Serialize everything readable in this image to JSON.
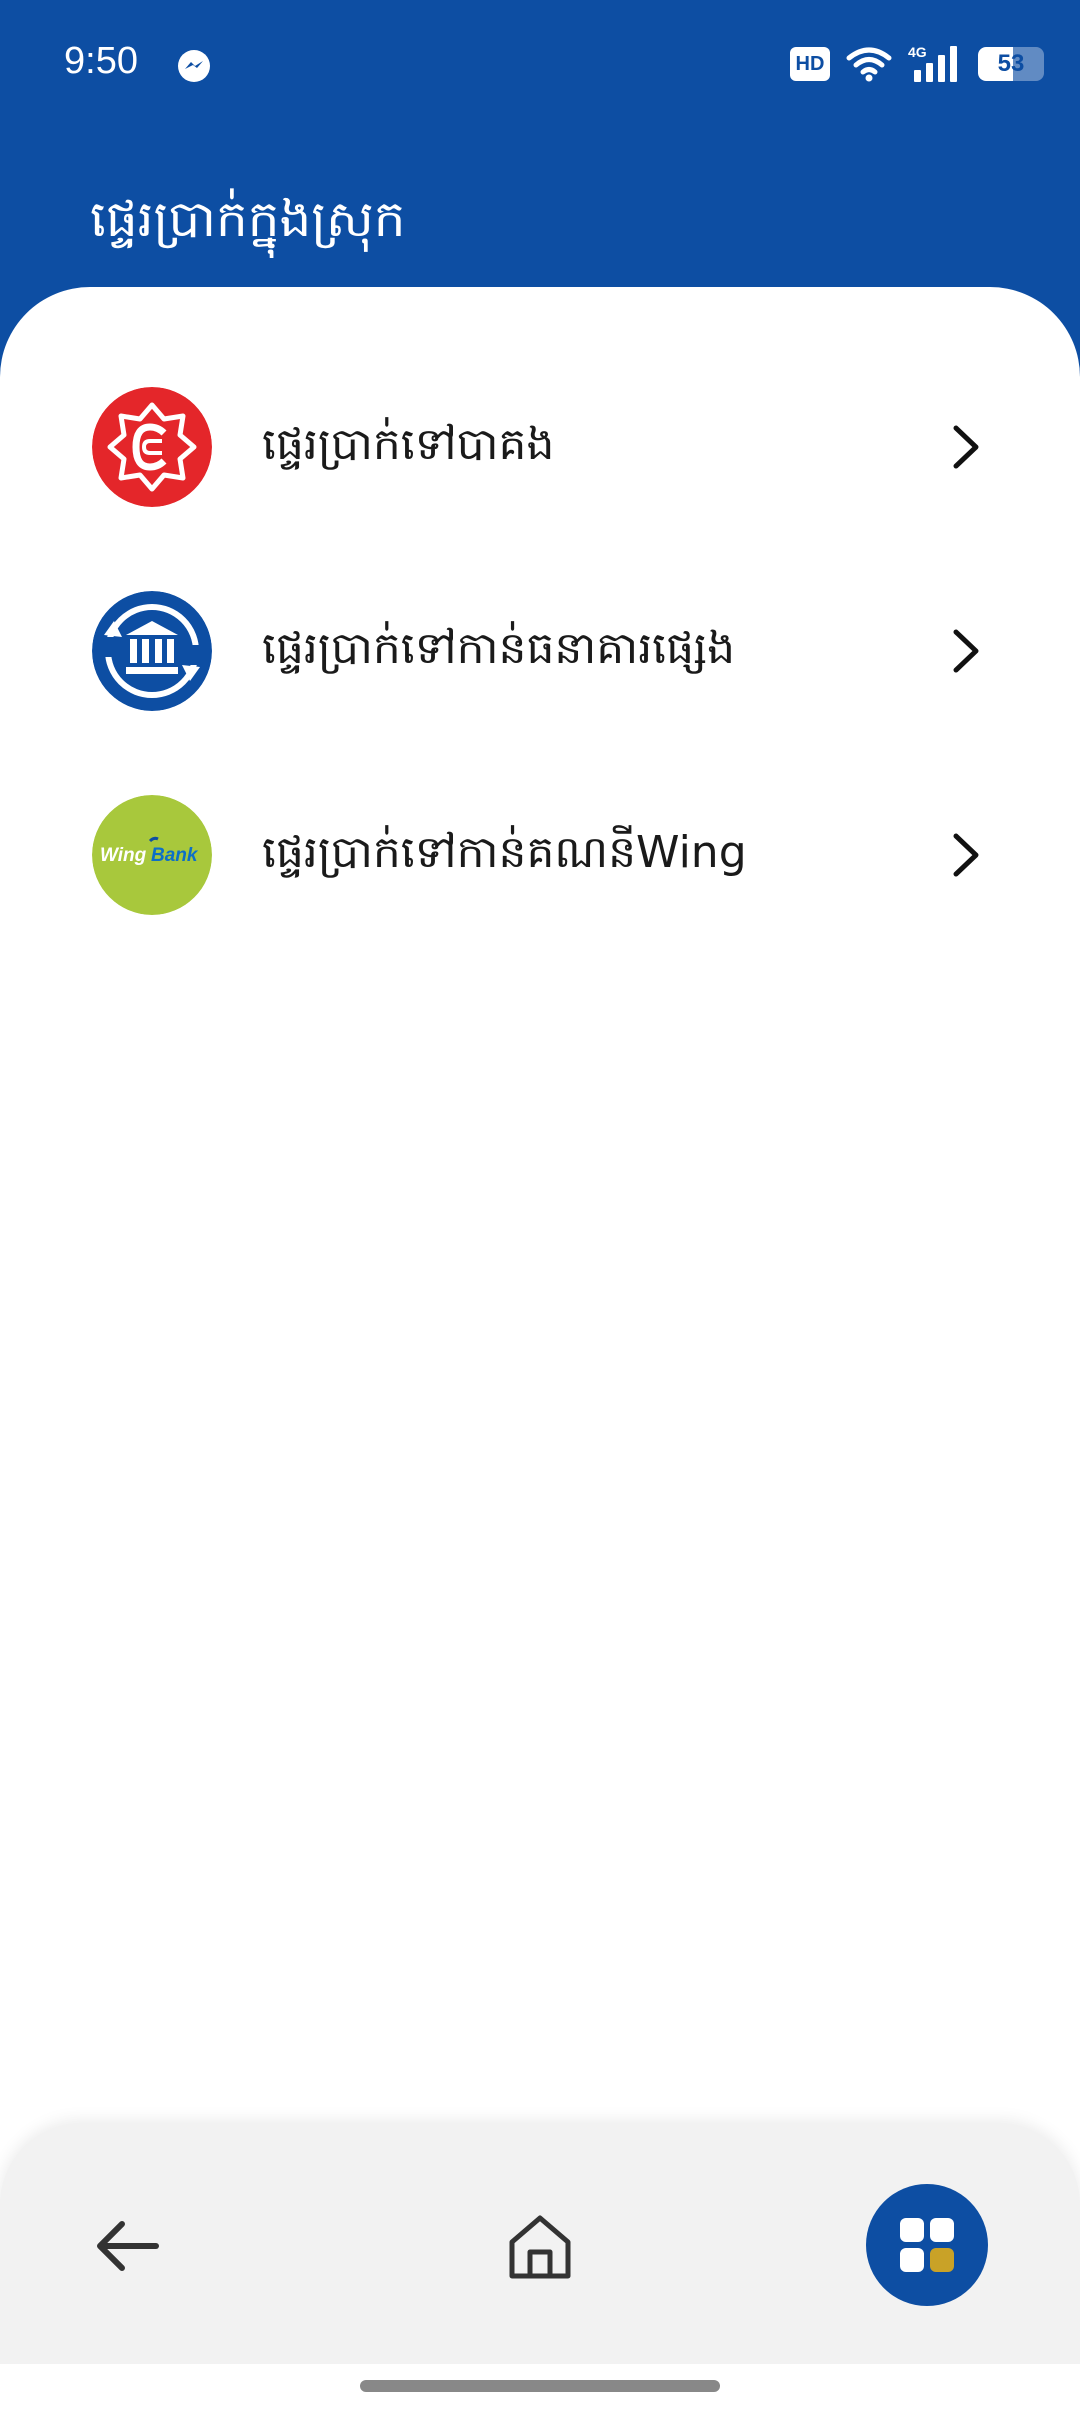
{
  "status_bar": {
    "time": "9:50",
    "network_badge": "HD",
    "signal_label": "4G",
    "battery_level": "53",
    "battery_fraction": 0.53,
    "icons": [
      "messenger-icon",
      "wifi-icon",
      "cellular-signal-icon",
      "battery-icon"
    ]
  },
  "header": {
    "title": "ផ្ទេរប្រាក់ក្នុងស្រុក",
    "background_color": "#0d4ea3"
  },
  "menu": {
    "items": [
      {
        "label": "ផ្ទេរប្រាក់ទៅបាគង",
        "icon": "bakong-logo-icon",
        "icon_color": "#e4262a"
      },
      {
        "label": "ផ្ទេរប្រាក់ទៅកាន់ធនាគារផ្សេង",
        "icon": "bank-transfer-icon",
        "icon_color": "#0d4ea3"
      },
      {
        "label": "ផ្ទេរប្រាក់ទៅកាន់គណនីWing",
        "icon": "wing-bank-logo-icon",
        "icon_color": "#a8c83c",
        "logo_text_wing": "Wing",
        "logo_text_bank": "Bank"
      }
    ]
  },
  "bottom_nav": {
    "icons": [
      "back-arrow-icon",
      "home-icon",
      "apps-grid-icon"
    ],
    "accent_color": "#0d4ea3",
    "highlight_color": "#c9a227"
  }
}
